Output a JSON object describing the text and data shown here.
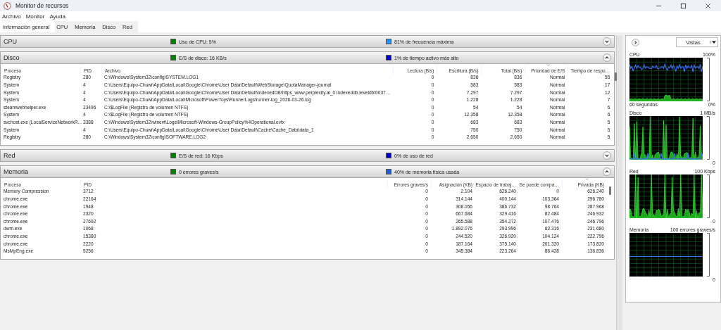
{
  "window": {
    "title": "Monitor de recursos"
  },
  "menu": [
    "Archivo",
    "Monitor",
    "Ayuda"
  ],
  "tabs": [
    {
      "label": "Información general",
      "selected": true
    },
    {
      "label": "CPU",
      "selected": false
    },
    {
      "label": "Memoria",
      "selected": false
    },
    {
      "label": "Disco",
      "selected": false
    },
    {
      "label": "Red",
      "selected": false
    }
  ],
  "sections": [
    {
      "title": "CPU",
      "expanded": false,
      "indicators": [
        {
          "text": "Uso de CPU: 5%",
          "color": "#008000"
        },
        {
          "text": "81% de frecuencia máxima",
          "color": "#1e90ff"
        }
      ]
    },
    {
      "title": "Disco",
      "expanded": true,
      "indicators": [
        {
          "text": "E/S de disco: 16 KB/s",
          "color": "#008000"
        },
        {
          "text": "1% de tiempo activo más alto",
          "color": "#0000cc"
        }
      ],
      "table": {
        "columns": [
          {
            "label": "Proceso",
            "kind": "text",
            "sorted": false
          },
          {
            "label": "PID",
            "kind": "text",
            "sorted": false
          },
          {
            "label": "Archivo",
            "kind": "text",
            "sorted": false
          },
          {
            "label": "Lectura (B/s)",
            "kind": "number",
            "sorted": false
          },
          {
            "label": "Escritura (B/s)",
            "kind": "number",
            "sorted": false
          },
          {
            "label": "Total (B/s)",
            "kind": "number",
            "sorted": false
          },
          {
            "label": "Prioridad de E/S",
            "kind": "number",
            "sorted": true
          },
          {
            "label": "Tiempo de respu…",
            "kind": "number",
            "sorted": false
          }
        ],
        "rows": [
          [
            "Registry",
            "280",
            "C:\\Windows\\System32\\config\\SYSTEM.LOG1",
            "0",
            "836",
            "836",
            "Normal",
            "55"
          ],
          [
            "System",
            "4",
            "C:\\Users\\Equipo-Chuwi\\AppData\\Local\\Google\\Chrome\\User Data\\Default\\WebStorage\\QuotaManager-journal",
            "0",
            "583",
            "583",
            "Normal",
            "17"
          ],
          [
            "System",
            "4",
            "C:\\Users\\Equipo-Chuwi\\AppData\\Local\\Google\\Chrome\\User Data\\Default\\IndexedDB\\https_www.perplexity.ai_0.indexeddb.leveldb\\0037…",
            "0",
            "7.297",
            "7.297",
            "Normal",
            "12"
          ],
          [
            "System",
            "4",
            "C:\\Users\\Equipo-Chuwi\\AppData\\Local\\Microsoft\\PowerToys\\RunnerLogs\\runner-log_2026-03-26.log",
            "0",
            "1.228",
            "1.228",
            "Normal",
            "7"
          ],
          [
            "steamwebhelper.exe",
            "23496",
            "C:\\$LogFile (Registro de volumen NTFS)",
            "0",
            "54",
            "54",
            "Normal",
            "6"
          ],
          [
            "System",
            "4",
            "C:\\$LogFile (Registro de volumen NTFS)",
            "0",
            "12.358",
            "12.358",
            "Normal",
            "6"
          ],
          [
            "svchost.exe (LocalServiceNetworkR…",
            "3388",
            "C:\\Windows\\System32\\winevt\\Logs\\Microsoft-Windows-GroupPolicy%4Operational.evtx",
            "0",
            "683",
            "683",
            "Normal",
            "5"
          ],
          [
            "System",
            "4",
            "C:\\Users\\Equipo-Chuwi\\AppData\\Local\\Google\\Chrome\\User Data\\Default\\Cache\\Cache_Data\\data_1",
            "0",
            "750",
            "750",
            "Normal",
            "5"
          ],
          [
            "Registry",
            "280",
            "C:\\Windows\\System32\\config\\SOFTWARE.LOG2",
            "0",
            "2.650",
            "2.650",
            "Normal",
            "5"
          ]
        ]
      }
    },
    {
      "title": "Red",
      "expanded": false,
      "indicators": [
        {
          "text": "E/S de red: 16 Kbps",
          "color": "#008000"
        },
        {
          "text": "0% de uso de red",
          "color": "#0000cc"
        }
      ]
    },
    {
      "title": "Memoria",
      "expanded": true,
      "indicators": [
        {
          "text": "0 errores graves/s",
          "color": "#008000"
        },
        {
          "text": "40% de memoria física usada",
          "color": "#1e5fd0"
        }
      ],
      "table": {
        "columns": [
          {
            "label": "Proceso",
            "kind": "text",
            "sorted": false
          },
          {
            "label": "PID",
            "kind": "text",
            "sorted": false
          },
          {
            "label": "Errores graves/s",
            "kind": "number",
            "sorted": false
          },
          {
            "label": "Asignación (KB)",
            "kind": "number",
            "sorted": false
          },
          {
            "label": "Espacio de trabaj…",
            "kind": "number",
            "sorted": false
          },
          {
            "label": "Se puede compa…",
            "kind": "number",
            "sorted": false
          },
          {
            "label": "Privada (KB)",
            "kind": "number",
            "sorted": true
          }
        ],
        "rows": [
          [
            "Memory Compression",
            "3712",
            "0",
            "2.104",
            "626.240",
            "0",
            "626.240"
          ],
          [
            "chrome.exe",
            "22164",
            "0",
            "314.144",
            "400.144",
            "103.364",
            "296.780"
          ],
          [
            "chrome.exe",
            "1948",
            "0",
            "308.056",
            "386.732",
            "98.764",
            "287.968"
          ],
          [
            "chrome.exe",
            "2320",
            "0",
            "667.684",
            "329.416",
            "82.484",
            "246.932"
          ],
          [
            "chrome.exe",
            "27692",
            "0",
            "265.588",
            "354.272",
            "107.476",
            "246.796"
          ],
          [
            "dwm.exe",
            "1068",
            "0",
            "1.892.076",
            "293.996",
            "62.316",
            "231.680"
          ],
          [
            "chrome.exe",
            "15380",
            "0",
            "244.520",
            "326.920",
            "104.124",
            "222.796"
          ],
          [
            "chrome.exe",
            "2220",
            "0",
            "187.164",
            "375.140",
            "201.320",
            "173.820"
          ],
          [
            "MsMpEng.exe",
            "5256",
            "0",
            "345.384",
            "223.264",
            "86.428",
            "136.836"
          ]
        ]
      }
    }
  ],
  "side": {
    "views_label": "Vistas",
    "graphs": [
      {
        "title": "CPU",
        "max_label": "100%",
        "time_label": "60 segundos",
        "min_label": "0%"
      },
      {
        "title": "Disco",
        "max_label": "1 MB/s",
        "min_label": "0"
      },
      {
        "title": "Red",
        "max_label": "100 Kbps",
        "min_label": "0"
      },
      {
        "title": "Memoria",
        "max_label": "100 errores graves/s",
        "min_label": "0"
      }
    ]
  }
}
